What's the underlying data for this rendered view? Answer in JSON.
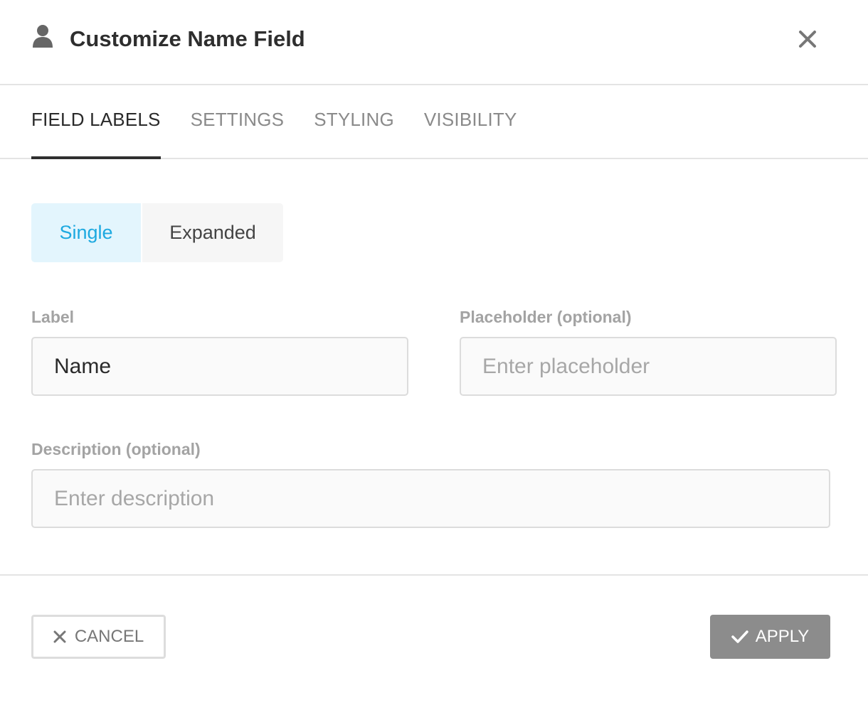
{
  "dialog": {
    "title": "Customize Name Field",
    "icons": {
      "title_icon": "user-icon",
      "close_icon": "close-icon"
    }
  },
  "tabs": [
    {
      "label": "FIELD LABELS",
      "active": true
    },
    {
      "label": "SETTINGS",
      "active": false
    },
    {
      "label": "STYLING",
      "active": false
    },
    {
      "label": "VISIBILITY",
      "active": false
    }
  ],
  "mode_toggle": {
    "options": [
      "Single",
      "Expanded"
    ],
    "selected": "Single"
  },
  "fields": {
    "label": {
      "caption": "Label",
      "value": "Name",
      "placeholder": ""
    },
    "placeholder": {
      "caption": "Placeholder (optional)",
      "value": "",
      "placeholder": "Enter placeholder"
    },
    "description": {
      "caption": "Description (optional)",
      "value": "",
      "placeholder": "Enter description"
    }
  },
  "footer": {
    "cancel_label": "CANCEL",
    "apply_label": "APPLY"
  },
  "colors": {
    "accent": "#1da9e0",
    "accent_bg": "#e3f5fd",
    "apply_bg": "#8c8c8c"
  }
}
